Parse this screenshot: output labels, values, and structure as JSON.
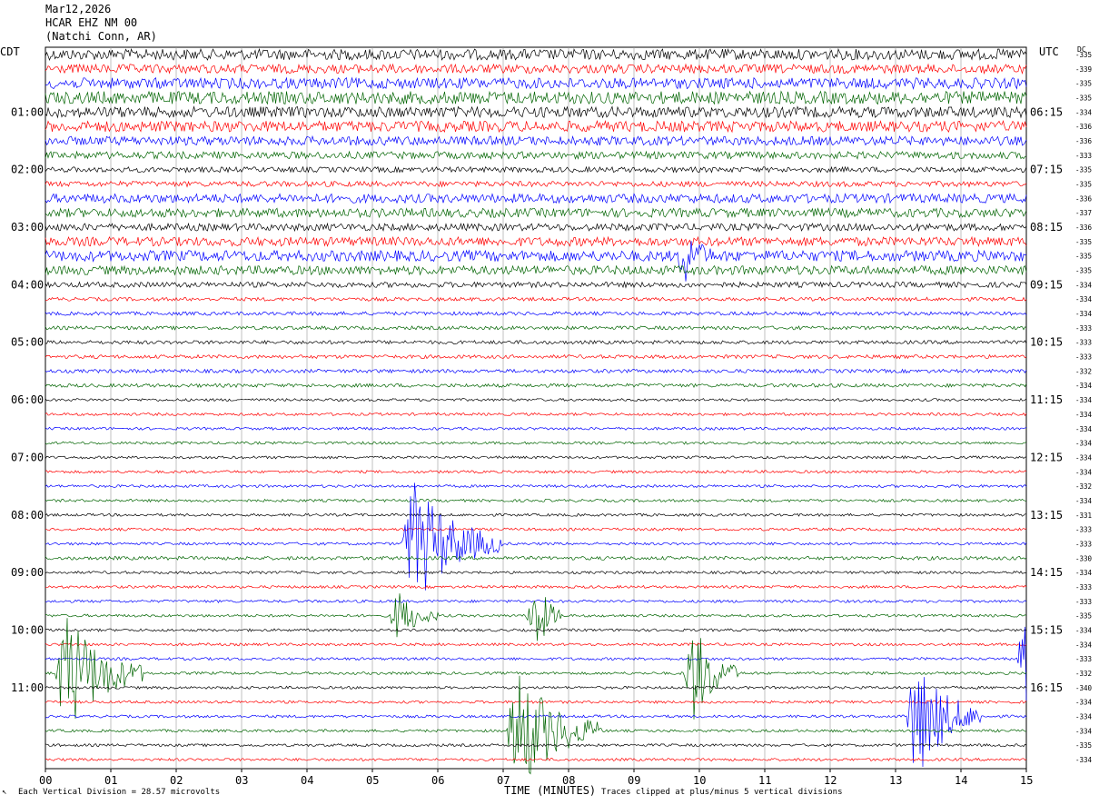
{
  "header": {
    "date": "Mar12,2026",
    "station": "HCAR EHZ NM 00",
    "location": "(Natchi Conn, AR)"
  },
  "left_zone": "CDT",
  "right_zone": "UTC",
  "dc_label": "DC",
  "footer": {
    "scale": "Each Vertical Division =   28.57 microvolts",
    "clip": "Traces clipped at plus/minus 5 vertical divisions",
    "corner": "↖"
  },
  "chart_data": {
    "type": "line",
    "title": "",
    "xlabel": "TIME (MINUTES)",
    "xlim": [
      0,
      15
    ],
    "x_ticks": [
      "00",
      "01",
      "02",
      "03",
      "04",
      "05",
      "06",
      "07",
      "08",
      "09",
      "10",
      "11",
      "12",
      "13",
      "14",
      "15"
    ],
    "left_hour_labels": [
      "01:00",
      "02:00",
      "03:00",
      "04:00",
      "05:00",
      "06:00",
      "07:00",
      "08:00",
      "09:00",
      "10:00",
      "11:00"
    ],
    "right_hour_labels": [
      "06:15",
      "07:15",
      "08:15",
      "09:15",
      "10:15",
      "11:15",
      "12:15",
      "13:15",
      "14:15",
      "15:15",
      "16:15"
    ],
    "trace_colors": [
      "#000000",
      "#ff0000",
      "#0000ff",
      "#006400"
    ],
    "dc_offsets": [
      "335",
      "339",
      "335",
      "335",
      "334",
      "336",
      "336",
      "333",
      "335",
      "335",
      "336",
      "337",
      "336",
      "335",
      "335",
      "335",
      "334",
      "334",
      "334",
      "333",
      "333",
      "333",
      "332",
      "334",
      "334",
      "334",
      "334",
      "334",
      "334",
      "334",
      "332",
      "334",
      "331",
      "333",
      "333",
      "330",
      "334",
      "333",
      "333",
      "335",
      "334",
      "334",
      "333",
      "332",
      "340",
      "334",
      "334",
      "334",
      "335",
      "334"
    ],
    "noise_levels": [
      6,
      5,
      6,
      7,
      6,
      6,
      5,
      4,
      3,
      3,
      5,
      5,
      4,
      5,
      6,
      5,
      3,
      2,
      2,
      2,
      2,
      2,
      2,
      2,
      1.5,
      1.5,
      1.5,
      1.5,
      1.5,
      1.5,
      1.5,
      1.5,
      1.5,
      1.5,
      1.5,
      2,
      1.5,
      1.5,
      1.5,
      1.5,
      1.5,
      1.5,
      1.5,
      1.5,
      1.5,
      1.5,
      1.5,
      1.5,
      1.5,
      1.5
    ],
    "events": [
      {
        "trace": 14,
        "minute": 9.8,
        "duration": 0.4,
        "amplitude": 2
      },
      {
        "trace": 34,
        "minute": 5.6,
        "duration": 1.4,
        "amplitude": 5
      },
      {
        "trace": 39,
        "minute": 7.5,
        "duration": 0.4,
        "amplitude": 3
      },
      {
        "trace": 39,
        "minute": 5.4,
        "duration": 0.6,
        "amplitude": 2
      },
      {
        "trace": 42,
        "minute": 15.0,
        "duration": 0.7,
        "amplitude": 4
      },
      {
        "trace": 43,
        "minute": 0.3,
        "duration": 1.2,
        "amplitude": 5
      },
      {
        "trace": 43,
        "minute": 9.9,
        "duration": 0.7,
        "amplitude": 4
      },
      {
        "trace": 46,
        "minute": 13.3,
        "duration": 1.0,
        "amplitude": 5
      },
      {
        "trace": 47,
        "minute": 7.2,
        "duration": 1.3,
        "amplitude": 5
      }
    ]
  }
}
